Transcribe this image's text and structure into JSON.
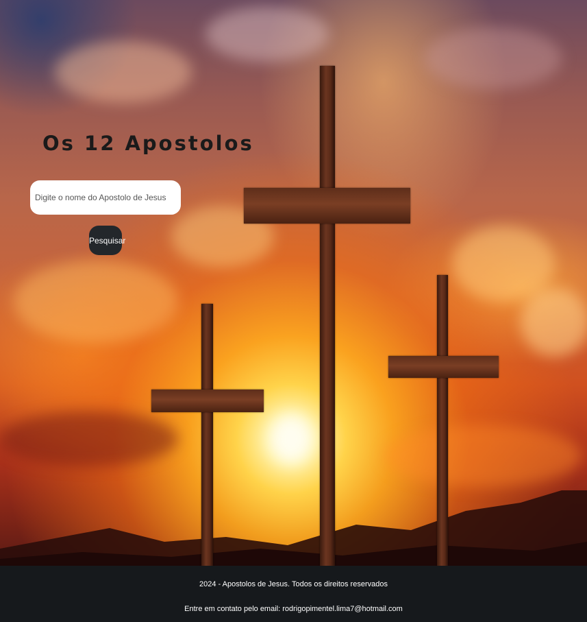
{
  "header": {
    "title": "Os 12 Apostolos"
  },
  "search": {
    "placeholder": "Digite o nome do Apostolo de Jesus",
    "value": "",
    "button_label": "Pesquisar",
    "button_color": "#23272b"
  },
  "background": {
    "subject": "three-wooden-crosses-sunset",
    "colors": [
      "#d0501f",
      "#ffd34a",
      "#6c4a5e",
      "#16191c"
    ]
  },
  "footer": {
    "copyright": "2024 - Apostolos de Jesus. Todos os direitos reservados",
    "contact": "Entre em contato pelo email: rodrigopimentel.lima7@hotmail.com",
    "background_color": "#16191c"
  }
}
